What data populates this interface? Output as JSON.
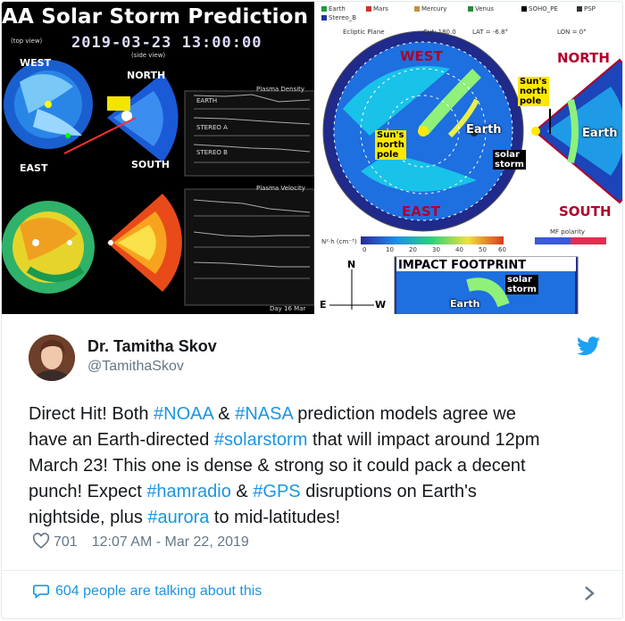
{
  "left_image": {
    "title": "AA Solar Storm Prediction Mo",
    "datetime": "2019-03-23  13:00:00",
    "top_view_label": "(top view)",
    "side_view_label": "(side view)",
    "labels": {
      "west": "WEST",
      "north": "NORTH",
      "east": "EAST",
      "south": "SOUTH"
    },
    "panel_titles": [
      "Plasma Density",
      "Plasma Velocity"
    ],
    "panel_rows": [
      "EARTH",
      "STEREO A",
      "STEREO B"
    ],
    "footer_text": "Day 16 Mar"
  },
  "right_image": {
    "legend": [
      "Earth",
      "Mars",
      "Mercury",
      "Venus",
      "SOHO_PE",
      "PSP",
      "Stereo_B"
    ],
    "plane_labels": [
      "Ecliptic Plane",
      "Cut: 180.0",
      "LAT = -6.8°",
      "LON = 0°"
    ],
    "west": "WEST",
    "east": "EAST",
    "north": "NORTH",
    "south": "SOUTH",
    "earth": "Earth",
    "sun_north_pole_lines": [
      "Sun's",
      "north",
      "pole"
    ],
    "solar_storm_lines": [
      "solar",
      "storm"
    ],
    "impact_footprint": "IMPACT FOOTPRINT",
    "compass": {
      "n": "N",
      "e": "E",
      "w": "W"
    },
    "colorbar_label": "N²·h (cm⁻³)",
    "colorbar_ticks": [
      "0",
      "10",
      "20",
      "30",
      "40",
      "50",
      "60"
    ],
    "mf_polarity": "MF polarity"
  },
  "author": {
    "name": "Dr. Tamitha Skov",
    "handle": "@TamithaSkov"
  },
  "tweet": {
    "lines": [
      [
        {
          "t": "Direct Hit! Both ",
          "tag": false
        },
        {
          "t": "#NOAA",
          "tag": true
        },
        {
          "t": " & ",
          "tag": false
        },
        {
          "t": "#NASA",
          "tag": true
        },
        {
          "t": " prediction models agree we",
          "tag": false
        }
      ],
      [
        {
          "t": "have an Earth-directed ",
          "tag": false
        },
        {
          "t": "#solarstorm",
          "tag": true
        },
        {
          "t": " that will impact around 12pm",
          "tag": false
        }
      ],
      [
        {
          "t": "March 23! This one is dense & strong so it could pack a decent",
          "tag": false
        }
      ],
      [
        {
          "t": "punch! Expect ",
          "tag": false
        },
        {
          "t": "#hamradio",
          "tag": true
        },
        {
          "t": " & ",
          "tag": false
        },
        {
          "t": "#GPS",
          "tag": true
        },
        {
          "t": " disruptions on Earth's",
          "tag": false
        }
      ],
      [
        {
          "t": "nightside, plus ",
          "tag": false
        },
        {
          "t": "#aurora",
          "tag": true
        },
        {
          "t": " to mid-latitudes!",
          "tag": false
        }
      ]
    ]
  },
  "meta": {
    "likes": "701",
    "timestamp": "12:07 AM - Mar 22, 2019"
  },
  "footer": {
    "talking": "604 people are talking about this"
  },
  "icons": {
    "bird": "twitter-bird-icon",
    "heart": "heart-icon",
    "bubble": "chat-bubble-icon",
    "chevron": "chevron-right-icon"
  },
  "colors": {
    "link": "#1b95e0",
    "secondary": "#657786",
    "text": "#14171a"
  }
}
